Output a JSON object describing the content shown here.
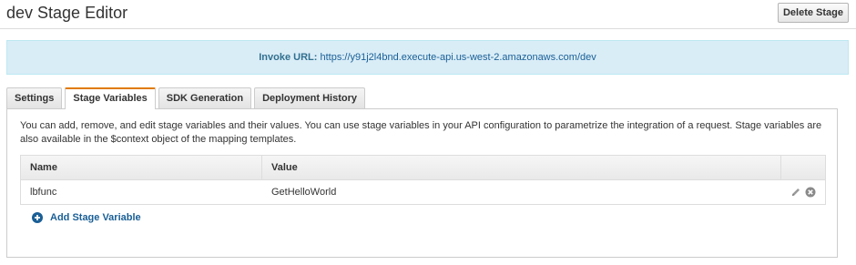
{
  "header": {
    "title": "dev Stage Editor",
    "delete_label": "Delete Stage"
  },
  "invoke": {
    "label": "Invoke URL:",
    "url": "https://y91j2l4bnd.execute-api.us-west-2.amazonaws.com/dev"
  },
  "tabs": [
    {
      "label": "Settings",
      "active": false
    },
    {
      "label": "Stage Variables",
      "active": true
    },
    {
      "label": "SDK Generation",
      "active": false
    },
    {
      "label": "Deployment History",
      "active": false
    }
  ],
  "panel": {
    "description": "You can add, remove, and edit stage variables and their values. You can use stage variables in your API configuration to parametrize the integration of a request. Stage variables are also available in the $context object of the mapping templates.",
    "table": {
      "columns": [
        "Name",
        "Value"
      ],
      "rows": [
        {
          "name": "lbfunc",
          "value": "GetHelloWorld"
        }
      ]
    },
    "add_label": "Add Stage Variable"
  },
  "icons": {
    "edit": "pencil-icon",
    "remove": "remove-circle-icon",
    "add": "plus-circle-icon"
  },
  "colors": {
    "accent_tab": "#e07b00",
    "link": "#1a5f96",
    "info_bg": "#d9edf7"
  }
}
